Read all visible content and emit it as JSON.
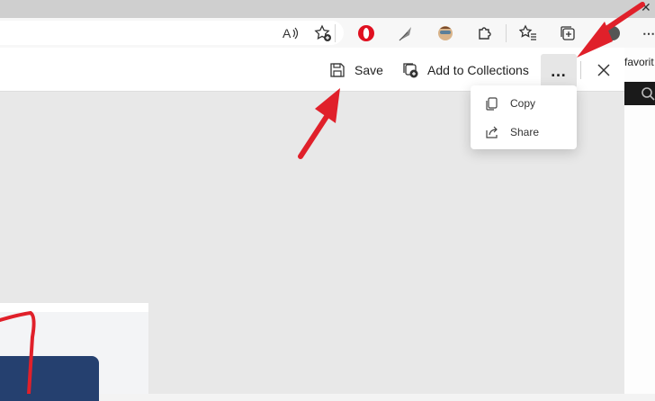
{
  "browser": {
    "favorites_label": "favorit",
    "toolbar_icons": [
      "read-aloud-icon",
      "favorite-add-icon",
      "opera-extension-icon",
      "feather-extension-icon",
      "avatar-extension-icon",
      "extensions-puzzle-icon",
      "favorites-icon",
      "collections-icon",
      "profile-icon",
      "more-icon"
    ]
  },
  "capture_toolbar": {
    "save_label": "Save",
    "add_to_collections_label": "Add to Collections",
    "more_label": "…"
  },
  "menu": {
    "items": [
      {
        "label": "Copy",
        "icon": "copy-icon"
      },
      {
        "label": "Share",
        "icon": "share-icon"
      }
    ]
  },
  "colors": {
    "annotation_arrow": "#e0202a",
    "card_blue": "#25406f"
  }
}
